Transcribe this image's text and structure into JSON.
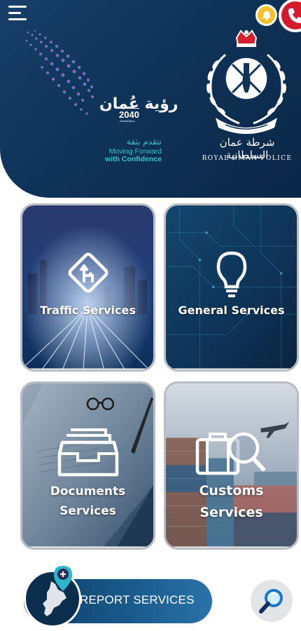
{
  "header": {
    "menu_icon": "hamburger-menu-icon",
    "notification_icon": "bell-icon",
    "call_icon": "phone-icon",
    "vision": {
      "arabic_title": "رؤية عُمان",
      "year": "2040",
      "sub": "OmanVision",
      "tagline_ar": "نتقدم بثقة",
      "tagline_line1": "Moving Forward",
      "tagline_line2": "with Confidence"
    },
    "police": {
      "arabic_name": "شرطة عمان السلطانية",
      "english_name": "ROYAL OMAN POLICE"
    }
  },
  "services": [
    {
      "label": "Traffic Services",
      "icon": "road-sign-icon"
    },
    {
      "label": "General Services",
      "icon": "lightbulb-icon"
    },
    {
      "label_line1": "Documents",
      "label_line2": "Services",
      "icon": "file-tray-icon"
    },
    {
      "label_line1": "Customs",
      "label_line2": "Services",
      "icon": "luggage-search-icon"
    }
  ],
  "report": {
    "label": "REPORT SERVICES",
    "icon": "oman-map-pin-icon"
  },
  "search": {
    "icon": "search-icon"
  },
  "colors": {
    "header_bg": "#0f3358",
    "accent_teal": "#2fc6c4",
    "bell": "#f5c12a",
    "phone": "#d31b2c"
  }
}
